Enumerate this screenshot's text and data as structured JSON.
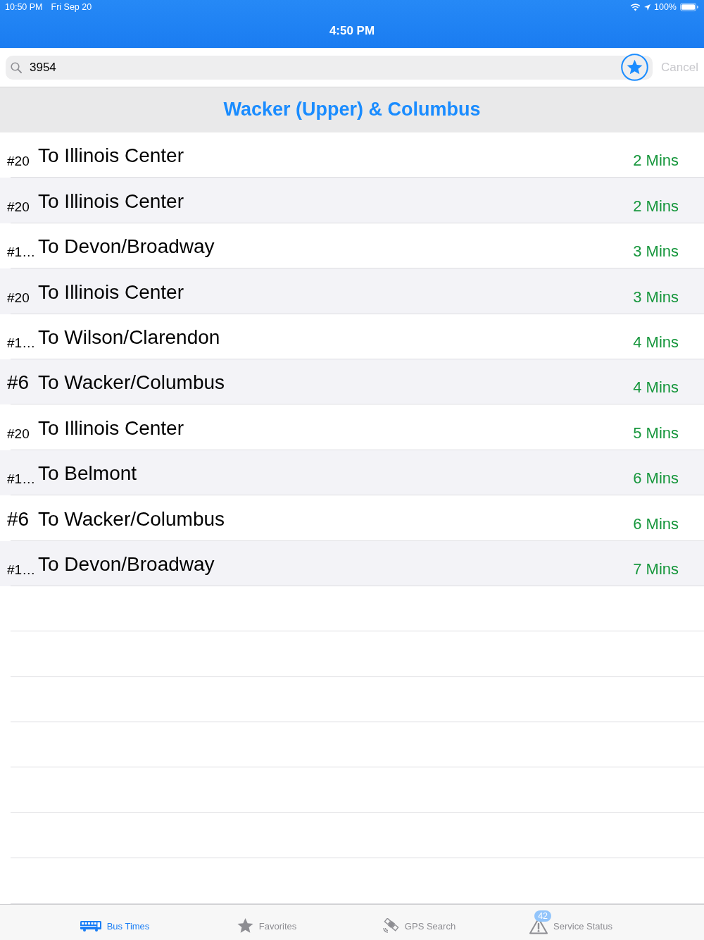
{
  "status_bar": {
    "time": "10:50 PM",
    "date": "Fri Sep 20",
    "battery": "100%"
  },
  "nav_bar": {
    "title": "4:50 PM"
  },
  "search": {
    "value": "3954",
    "cancel": "Cancel"
  },
  "stop": {
    "title": "Wacker (Upper) & Columbus"
  },
  "arrivals": [
    {
      "route": "#20",
      "destination": "To Illinois Center",
      "eta": "2 Mins"
    },
    {
      "route": "#20",
      "destination": "To Illinois Center",
      "eta": "2 Mins"
    },
    {
      "route": "#1…",
      "destination": "To Devon/Broadway",
      "eta": "3 Mins"
    },
    {
      "route": "#20",
      "destination": "To Illinois Center",
      "eta": "3 Mins"
    },
    {
      "route": "#1…",
      "destination": "To Wilson/Clarendon",
      "eta": "4 Mins"
    },
    {
      "route": "#6",
      "destination": "To Wacker/Columbus",
      "eta": "4 Mins"
    },
    {
      "route": "#20",
      "destination": "To Illinois Center",
      "eta": "5 Mins"
    },
    {
      "route": "#1…",
      "destination": "To Belmont",
      "eta": "6 Mins"
    },
    {
      "route": "#6",
      "destination": "To Wacker/Columbus",
      "eta": "6 Mins"
    },
    {
      "route": "#1…",
      "destination": "To Devon/Broadway",
      "eta": "7 Mins"
    }
  ],
  "tabs": [
    {
      "label": "Bus Times",
      "selected": true
    },
    {
      "label": "Favorites",
      "selected": false
    },
    {
      "label": "GPS Search",
      "selected": false
    },
    {
      "label": "Service Status",
      "selected": false,
      "badge": "42"
    }
  ]
}
